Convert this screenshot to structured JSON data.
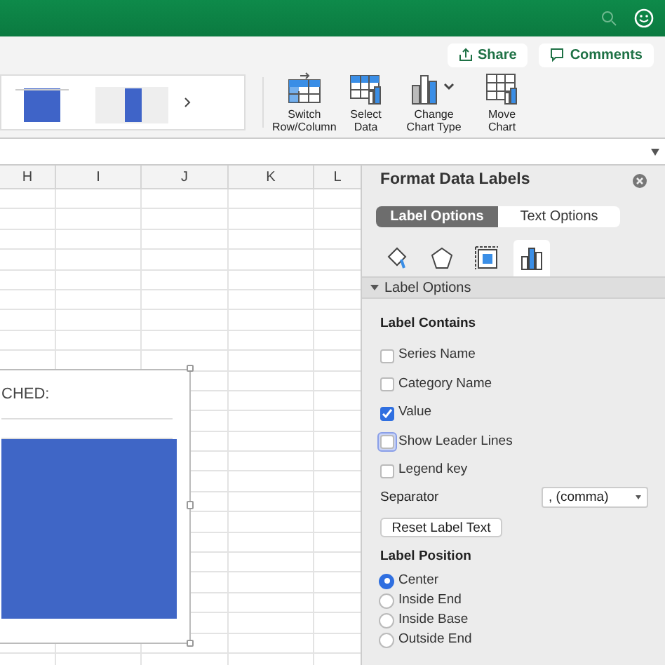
{
  "toolbar": {
    "share": "Share",
    "comments": "Comments"
  },
  "ribbon": {
    "buttons": [
      {
        "label": "Switch\nRow/Column",
        "kind": "switch"
      },
      {
        "label": "Select\nData",
        "kind": "select"
      },
      {
        "label": "Change\nChart Type",
        "kind": "change"
      },
      {
        "label": "Move\nChart",
        "kind": "move"
      }
    ]
  },
  "sheet": {
    "columns": [
      "H",
      "I",
      "J",
      "K",
      "L"
    ],
    "chart": {
      "title": "CHED:"
    }
  },
  "pane": {
    "title": "Format Data Labels",
    "tabs": [
      {
        "label": "Label Options",
        "selected": true
      },
      {
        "label": "Text Options",
        "selected": false
      }
    ],
    "icon_tabs": [
      {
        "kind": "fill",
        "selected": false
      },
      {
        "kind": "shape",
        "selected": false
      },
      {
        "kind": "size",
        "selected": false
      },
      {
        "kind": "chart",
        "selected": true
      }
    ],
    "section": {
      "title": "Label Options",
      "expanded": true
    },
    "contains_heading": "Label Contains",
    "checkboxes": [
      {
        "label": "Series Name",
        "checked": false,
        "focused": false
      },
      {
        "label": "Category Name",
        "checked": false,
        "focused": false
      },
      {
        "label": "Value",
        "checked": true,
        "focused": false
      },
      {
        "label": "Show Leader Lines",
        "checked": false,
        "focused": true
      },
      {
        "label": "Legend key",
        "checked": false,
        "focused": false
      }
    ],
    "separator": {
      "label": "Separator",
      "value": ", (comma)"
    },
    "reset_button": "Reset Label Text",
    "position_heading": "Label Position",
    "positions": [
      {
        "label": "Center",
        "selected": true
      },
      {
        "label": "Inside End",
        "selected": false
      },
      {
        "label": "Inside Base",
        "selected": false
      },
      {
        "label": "Outside End",
        "selected": false
      }
    ]
  }
}
